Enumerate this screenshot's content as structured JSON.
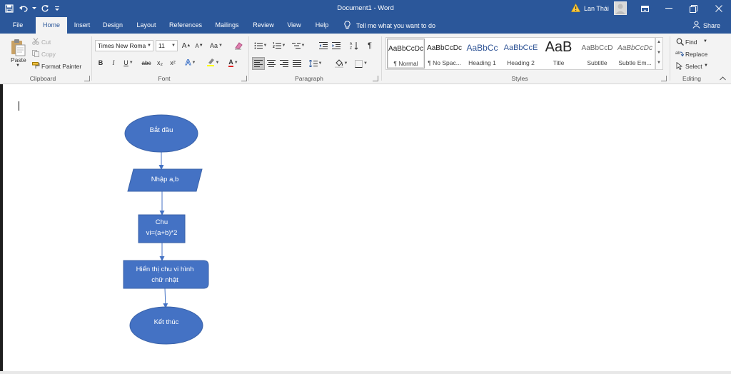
{
  "app": {
    "doc_title": "Document1 - Word",
    "user_name": "Lan Thái"
  },
  "tabs": [
    "File",
    "Home",
    "Insert",
    "Design",
    "Layout",
    "References",
    "Mailings",
    "Review",
    "View",
    "Help"
  ],
  "active_tab": "Home",
  "tell_me": "Tell me what you want to do",
  "share_label": "Share",
  "clipboard": {
    "group_label": "Clipboard",
    "paste": "Paste",
    "cut": "Cut",
    "copy": "Copy",
    "format_painter": "Format Painter"
  },
  "font": {
    "group_label": "Font",
    "font_name": "Times New Roma",
    "font_size": "11",
    "bold": "B",
    "italic": "I",
    "underline": "U",
    "strike": "abc",
    "subscript": "x₂",
    "superscript": "x²",
    "change_case": "Aa",
    "grow": "A",
    "shrink": "A",
    "effects": "A",
    "font_color": "A"
  },
  "paragraph": {
    "group_label": "Paragraph"
  },
  "styles": {
    "group_label": "Styles",
    "items": [
      {
        "preview": "AaBbCcDc",
        "name": "¶ Normal"
      },
      {
        "preview": "AaBbCcDc",
        "name": "¶ No Spac..."
      },
      {
        "preview": "AaBbCc",
        "name": "Heading 1"
      },
      {
        "preview": "AaBbCcE",
        "name": "Heading 2"
      },
      {
        "preview": "AaB",
        "name": "Title"
      },
      {
        "preview": "AaBbCcD",
        "name": "Subtitle"
      },
      {
        "preview": "AaBbCcDc",
        "name": "Subtle Em..."
      }
    ]
  },
  "editing": {
    "group_label": "Editing",
    "find": "Find",
    "replace": "Replace",
    "select": "Select"
  },
  "flowchart": {
    "fill": "#4472c4",
    "start": "Bắt đầu",
    "input": "Nhập a,b",
    "process_line1": "Chu",
    "process_line2": "vi=(a+b)*2",
    "output_line1": "Hiển thị chu vi hình",
    "output_line2": "chữ nhật",
    "end": "Kết thúc"
  },
  "colors": {
    "title_bar": "#2b579a",
    "ribbon": "#f3f3f3",
    "shape_fill": "#4472c4",
    "arrow": "#4472c4"
  }
}
